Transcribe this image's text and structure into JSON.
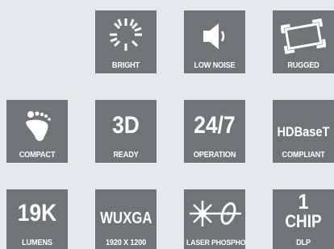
{
  "tiles": {
    "bright": {
      "caption": "BRIGHT"
    },
    "lownoise": {
      "caption": "LOW NOISE"
    },
    "rugged": {
      "caption": "RUGGED"
    },
    "compact": {
      "caption": "COMPACT"
    },
    "ready3d": {
      "big": "3D",
      "caption": "READY"
    },
    "op247": {
      "big": "24/7",
      "caption": "OPERATION"
    },
    "hdbaset": {
      "big": "HDBaseT",
      "caption": "COMPLIANT"
    },
    "lumens": {
      "big": "19K",
      "caption": "LUMENS"
    },
    "wuxga": {
      "big": "WUXGA",
      "caption": "1920 X 1200"
    },
    "laser": {
      "caption": "LASER PHOSPHOR"
    },
    "chip": {
      "line1": "1",
      "line2": "CHIP",
      "caption": "DLP"
    }
  },
  "colors": {
    "tile": "#6f7477",
    "background": "#e5e9ec",
    "text": "#ffffff"
  },
  "icons": [
    "sunburst-icon",
    "speaker-icon",
    "rugged-frame-icon",
    "footprint-icon",
    "laser-phosphor-icon"
  ]
}
